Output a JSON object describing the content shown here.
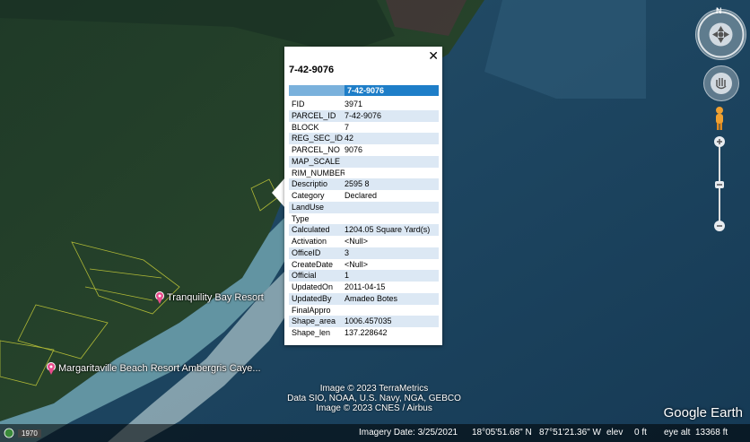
{
  "popup": {
    "title": "7-42-9076",
    "close_glyph": "✕",
    "header_value": "7-42-9076",
    "rows": [
      {
        "key": "FID",
        "value": "3971"
      },
      {
        "key": "PARCEL_ID",
        "value": "7-42-9076"
      },
      {
        "key": "BLOCK",
        "value": "7"
      },
      {
        "key": "REG_SEC_ID",
        "value": "42"
      },
      {
        "key": "PARCEL_NO",
        "value": "9076"
      },
      {
        "key": "MAP_SCALE",
        "value": ""
      },
      {
        "key": "RIM_NUMBER",
        "value": ""
      },
      {
        "key": "Descriptio",
        "value": "2595 8"
      },
      {
        "key": "Category",
        "value": "Declared"
      },
      {
        "key": "LandUse",
        "value": ""
      },
      {
        "key": "Type",
        "value": ""
      },
      {
        "key": "Calculated",
        "value": "1204.05 Square Yard(s)"
      },
      {
        "key": "Activation",
        "value": "<Null>"
      },
      {
        "key": "OfficeID",
        "value": "3"
      },
      {
        "key": "CreateDate",
        "value": "<Null>"
      },
      {
        "key": "Official",
        "value": "1"
      },
      {
        "key": "UpdatedOn",
        "value": "2011-04-15"
      },
      {
        "key": "UpdatedBy",
        "value": "Amadeo Botes"
      },
      {
        "key": "FinalAppro",
        "value": ""
      },
      {
        "key": "Shape_area",
        "value": "1006.457035"
      },
      {
        "key": "Shape_len",
        "value": "137.228642"
      }
    ]
  },
  "places": {
    "tranquility": "Tranquility Bay Resort",
    "margaritaville": "Margaritaville Beach Resort Ambergris Caye..."
  },
  "credits": {
    "line1": "Image © 2023 TerraMetrics",
    "line2": "Data SIO, NOAA, U.S. Navy, NGA, GEBCO",
    "line3": "Image © 2023 CNES / Airbus"
  },
  "logo": "Google Earth",
  "compass_north": "N",
  "status": {
    "year": "1970",
    "imagery_date": "Imagery Date: 3/25/2021",
    "lat": "18°05'51.68\" N",
    "lon": "87°51'21.36\" W",
    "elev_label": "elev",
    "elev_value": "0 ft",
    "eye_alt_label": "eye alt",
    "eye_alt_value": "13368 ft"
  },
  "colors": {
    "popup_header": "#1e7ec8",
    "row_alt": "#dce8f4",
    "ocean": "#1c4a6a",
    "land": "#2a4a2a",
    "parcel_lines": "#d4d83a"
  },
  "icons": {
    "pin": "pink-placemark-icon",
    "pegman": "pegman-icon"
  }
}
